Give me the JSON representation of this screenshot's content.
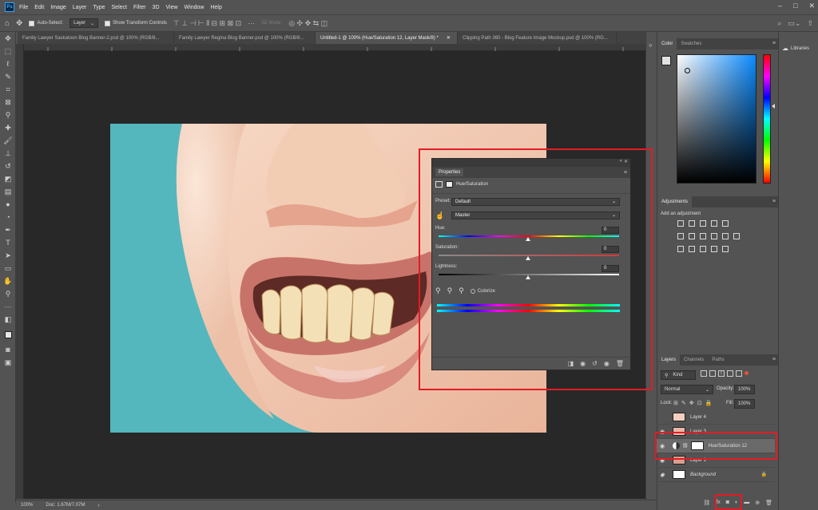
{
  "app": {
    "logo": "Ps",
    "menu": [
      "File",
      "Edit",
      "Image",
      "Layer",
      "Type",
      "Select",
      "Filter",
      "3D",
      "View",
      "Window",
      "Help"
    ]
  },
  "options": {
    "auto_select_label": "Auto-Select:",
    "auto_select_value": "Layer",
    "show_transform_label": "Show Transform Controls",
    "mode_3d": "3D Mode:"
  },
  "tabs": [
    {
      "label": "Family Lawyer Saskatoon Blog Banner-2.psd @ 100% (RGB/8...",
      "active": false
    },
    {
      "label": "Family Lawyer Regina Blog Banner.psd @ 100% (RGB/8...",
      "active": false
    },
    {
      "label": "Untitled-1 @ 100% (Hue/Saturation 12, Layer Mask/8) *",
      "active": true
    },
    {
      "label": "Clipping Path 360 - Blog Feature Image Mockup.psd @ 100% (RG...",
      "active": false
    }
  ],
  "status": {
    "zoom": "100%",
    "doc": "Doc: 1.67M/7.07M"
  },
  "properties": {
    "title": "Properties",
    "adjustment": "Hue/Saturation",
    "preset_label": "Preset:",
    "preset_value": "Default",
    "channel_value": "Master",
    "hue_label": "Hue:",
    "hue_value": "0",
    "saturation_label": "Saturation:",
    "saturation_value": "0",
    "lightness_label": "Lightness:",
    "lightness_value": "0",
    "colorize_label": "Colorize"
  },
  "color_panel": {
    "tabs": [
      "Color",
      "Swatches"
    ]
  },
  "adjustments": {
    "title": "Adjustments",
    "hint": "Add an adjustment"
  },
  "layers_panel": {
    "tabs": [
      "Layers",
      "Channels",
      "Paths"
    ],
    "kind": "Kind",
    "blend": "Normal",
    "opacity_label": "Opacity:",
    "opacity_value": "100%",
    "lock_label": "Lock:",
    "fill_label": "Fill:",
    "fill_value": "100%",
    "layers": [
      {
        "name": "Layer 4",
        "visible": false
      },
      {
        "name": "Layer 3",
        "visible": true
      },
      {
        "name": "Hue/Saturation 12",
        "visible": true
      },
      {
        "name": "Layer 1",
        "visible": true
      },
      {
        "name": "Background",
        "visible": true
      }
    ]
  },
  "libraries": {
    "label": "Libraries"
  },
  "colors": {
    "highlight": "#e21c24",
    "panel": "#535353",
    "dark": "#282828"
  }
}
